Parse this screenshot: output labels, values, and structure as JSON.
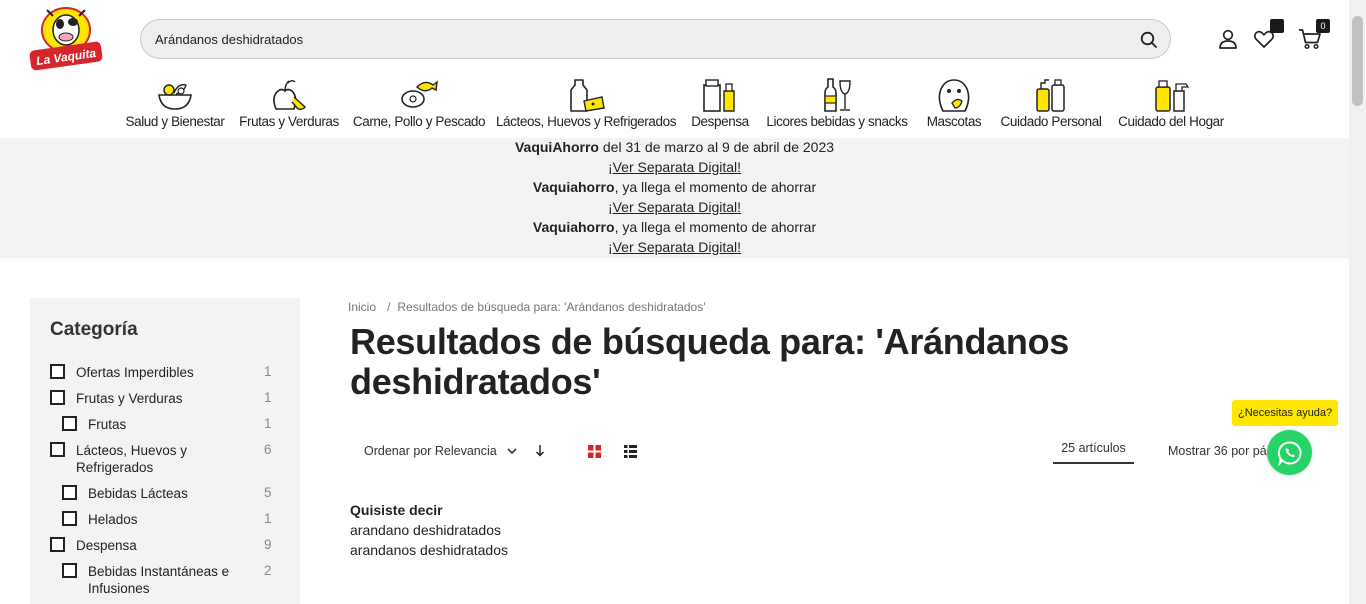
{
  "header": {
    "logo_text": "La Vaquita",
    "search": {
      "value": "Arándanos deshidratados"
    },
    "wishlist_count": "",
    "cart_count": "0"
  },
  "categories": [
    {
      "label": "Salud y Bienestar",
      "icon": "salad-bowl-icon"
    },
    {
      "label": "Frutas y Verduras",
      "icon": "fruits-icon"
    },
    {
      "label": "Carne, Pollo y Pescado",
      "icon": "meat-fish-icon"
    },
    {
      "label": "Lácteos, Huevos y Refrigerados",
      "icon": "dairy-icon"
    },
    {
      "label": "Despensa",
      "icon": "pantry-icon"
    },
    {
      "label": "Licores bebidas y snacks",
      "icon": "drinks-icon"
    },
    {
      "label": "Mascotas",
      "icon": "pet-icon"
    },
    {
      "label": "Cuidado Personal",
      "icon": "personal-care-icon"
    },
    {
      "label": "Cuidado del Hogar",
      "icon": "home-care-icon"
    }
  ],
  "promo": {
    "line1_bold": "VaquiAhorro",
    "line1_rest": " del 31 de marzo al 9 de abril de 2023",
    "link1": "¡Ver Separata Digital!",
    "line2_bold": "Vaquiahorro",
    "line2_rest": ", ya llega el momento de ahorrar",
    "link2": "¡Ver Separata Digital!",
    "line3_bold": "Vaquiahorro",
    "line3_rest": ", ya llega el momento de ahorrar",
    "link3": "¡Ver Separata Digital!"
  },
  "sidebar": {
    "title": "Categoría",
    "filters": [
      {
        "label": "Ofertas Imperdibles",
        "count": "1"
      },
      {
        "label": "Frutas y Verduras",
        "count": "1"
      },
      {
        "label": "Frutas",
        "count": "1"
      },
      {
        "label": "Lácteos, Huevos y Refrigerados",
        "count": "6"
      },
      {
        "label": "Bebidas Lácteas",
        "count": "5"
      },
      {
        "label": "Helados",
        "count": "1"
      },
      {
        "label": "Despensa",
        "count": "9"
      },
      {
        "label": "Bebidas Instantáneas e Infusiones",
        "count": "2"
      }
    ]
  },
  "breadcrumb": {
    "home": "Inicio",
    "current": "Resultados de búsqueda para: 'Arándanos deshidratados'"
  },
  "results": {
    "title": "Resultados de búsqueda para: 'Arándanos deshidratados'",
    "sort_label": "Ordenar por Relevancia",
    "count_label": "25 artículos",
    "per_page_label": "Mostrar 36 por pág"
  },
  "suggestions": {
    "title": "Quisiste decir",
    "items": [
      "arandano deshidratados",
      "arandanos deshidratados"
    ]
  },
  "help": {
    "bubble": "¿Necesitas ayuda?"
  },
  "colors": {
    "accent": "#ffe600",
    "brand_red": "#d8252c",
    "whatsapp": "#25d366",
    "band": "#f3f3f3"
  }
}
